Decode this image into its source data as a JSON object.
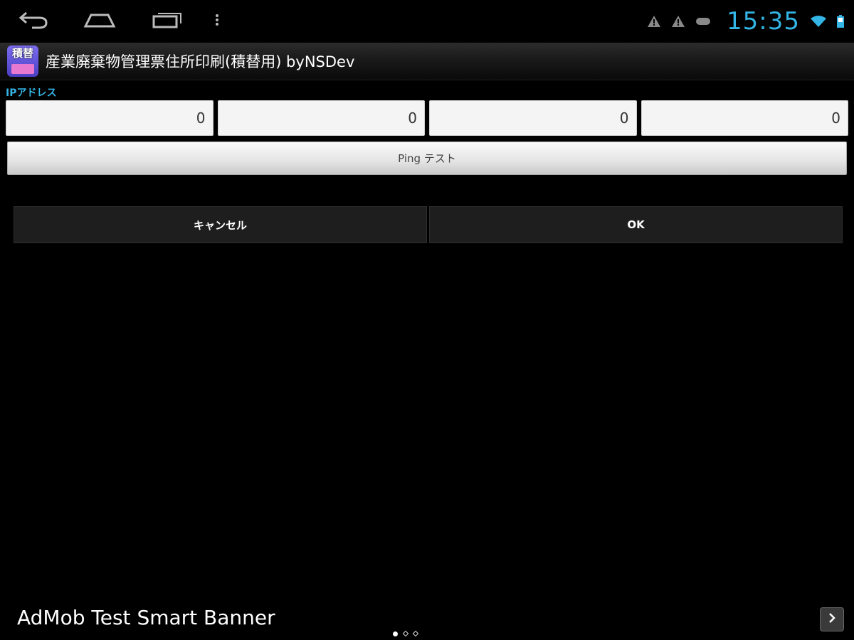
{
  "status_bar": {
    "time": "15:35",
    "clock_color": "#33b5e5",
    "nav_icons": [
      "back-icon",
      "home-icon",
      "recent-apps-icon",
      "overflow-menu-icon"
    ],
    "status_icons": [
      "warning-icon",
      "warning-icon",
      "game-controller-icon",
      "wifi-icon",
      "battery-icon"
    ]
  },
  "action_bar": {
    "title": "産業廃棄物管理票住所印刷(積替用) byNSDev",
    "icon_text": "積替"
  },
  "form": {
    "ip_label": "IPアドレス",
    "ip_octets": [
      "0",
      "0",
      "0",
      "0"
    ],
    "ping_button": "Ping テスト",
    "cancel_button": "キャンセル",
    "ok_button": "OK"
  },
  "ad": {
    "text": "AdMob Test Smart Banner",
    "page_indicator": {
      "count": 3,
      "active": 1
    }
  },
  "colors": {
    "accent": "#33b5e5",
    "background": "#000000"
  }
}
